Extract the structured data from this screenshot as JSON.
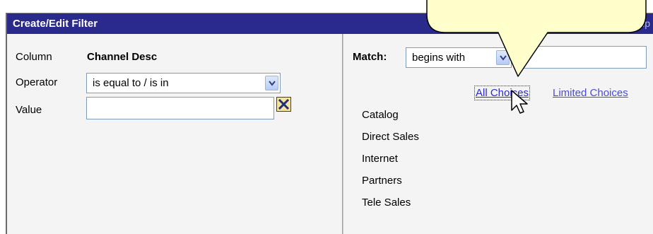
{
  "dialog": {
    "title": "Create/Edit Filter",
    "help_label": "Help"
  },
  "left": {
    "column_label": "Column",
    "column_value": "Channel Desc",
    "operator_label": "Operator",
    "operator_value": "is equal to / is in",
    "value_label": "Value",
    "value_input": ""
  },
  "right": {
    "match_label": "Match:",
    "match_value": "begins with",
    "match_input": "",
    "all_choices_label": "All Choices",
    "limited_choices_label": "Limited Choices",
    "values": [
      "Catalog",
      "Direct Sales",
      "Internet",
      "Partners",
      "Tele Sales"
    ]
  },
  "colors": {
    "title_bar": "#2a2a8c",
    "link": "#4b4bd6",
    "callout_fill": "#ffffcc"
  }
}
